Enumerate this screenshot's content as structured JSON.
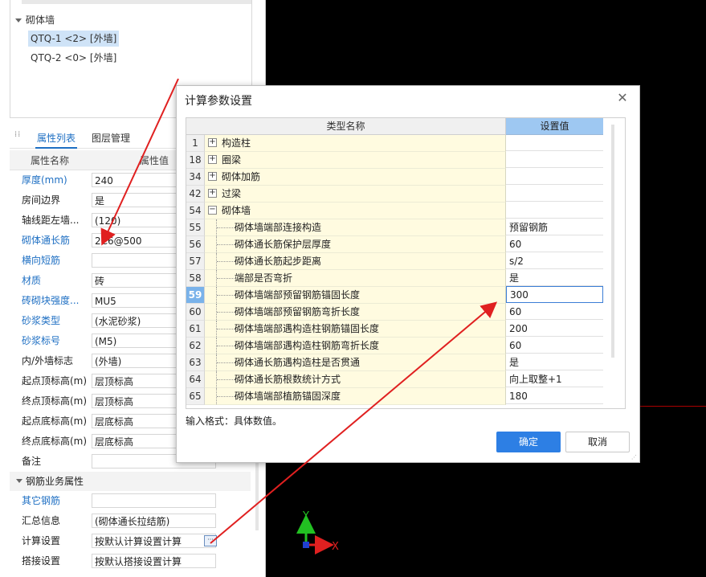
{
  "tree": {
    "group_label": "砌体墙",
    "items": [
      {
        "label": "QTQ-1 <2> [外墙]",
        "selected": true
      },
      {
        "label": "QTQ-2 <0> [外墙]",
        "selected": false
      }
    ]
  },
  "panel_tabs": {
    "properties": "属性列表",
    "layers": "图层管理"
  },
  "prop_header": {
    "name": "属性名称",
    "value": "属性值"
  },
  "props": [
    {
      "name": "厚度(mm)",
      "value": "240",
      "blue": true
    },
    {
      "name": "房间边界",
      "value": "是",
      "blue": false
    },
    {
      "name": "轴线距左墙...",
      "value": "(120)",
      "blue": false
    },
    {
      "name": "砌体通长筋",
      "value": "2C6@500",
      "blue": true
    },
    {
      "name": "横向短筋",
      "value": "",
      "blue": true
    },
    {
      "name": "材质",
      "value": "砖",
      "blue": true
    },
    {
      "name": "砖砌块强度...",
      "value": "MU5",
      "blue": true
    },
    {
      "name": "砂浆类型",
      "value": "(水泥砂浆)",
      "blue": true
    },
    {
      "name": "砂浆标号",
      "value": "(M5)",
      "blue": true
    },
    {
      "name": "内/外墙标志",
      "value": "(外墙)",
      "blue": false
    },
    {
      "name": "起点顶标高(m)",
      "value": "层顶标高",
      "blue": false
    },
    {
      "name": "终点顶标高(m)",
      "value": "层顶标高",
      "blue": false
    },
    {
      "name": "起点底标高(m)",
      "value": "层底标高",
      "blue": false
    },
    {
      "name": "终点底标高(m)",
      "value": "层底标高",
      "blue": false
    },
    {
      "name": "备注",
      "value": "",
      "blue": false
    }
  ],
  "rebar_section": {
    "title": "钢筋业务属性",
    "rows": [
      {
        "name": "其它钢筋",
        "value": "",
        "blue": true
      },
      {
        "name": "汇总信息",
        "value": "(砌体通长拉结筋)",
        "blue": false
      },
      {
        "name": "计算设置",
        "value": "按默认计算设置计算",
        "blue": false
      },
      {
        "name": "搭接设置",
        "value": "按默认搭接设置计算",
        "blue": false
      }
    ]
  },
  "dialog": {
    "title": "计算参数设置",
    "close_icon": "close-icon",
    "col_name": "类型名称",
    "col_value": "设置值",
    "rows": [
      {
        "num": "1",
        "name": "构造柱",
        "value": "",
        "group": true,
        "expanded": false
      },
      {
        "num": "18",
        "name": "圈梁",
        "value": "",
        "group": true,
        "expanded": false
      },
      {
        "num": "34",
        "name": "砌体加筋",
        "value": "",
        "group": true,
        "expanded": false
      },
      {
        "num": "42",
        "name": "过梁",
        "value": "",
        "group": true,
        "expanded": false
      },
      {
        "num": "54",
        "name": "砌体墙",
        "value": "",
        "group": true,
        "expanded": true
      },
      {
        "num": "55",
        "name": "砌体墙端部连接构造",
        "value": "预留钢筋"
      },
      {
        "num": "56",
        "name": "砌体通长筋保护层厚度",
        "value": "60"
      },
      {
        "num": "57",
        "name": "砌体通长筋起步距离",
        "value": "s/2"
      },
      {
        "num": "58",
        "name": "端部是否弯折",
        "value": "是"
      },
      {
        "num": "59",
        "name": "砌体墙端部预留钢筋锚固长度",
        "value": "300",
        "editing": true
      },
      {
        "num": "60",
        "name": "砌体墙端部预留钢筋弯折长度",
        "value": "60"
      },
      {
        "num": "61",
        "name": "砌体墙端部遇构造柱钢筋锚固长度",
        "value": "200"
      },
      {
        "num": "62",
        "name": "砌体墙端部遇构造柱钢筋弯折长度",
        "value": "60"
      },
      {
        "num": "63",
        "name": "砌体通长筋遇构造柱是否贯通",
        "value": "是"
      },
      {
        "num": "64",
        "name": "砌体通长筋根数统计方式",
        "value": "向上取整+1"
      },
      {
        "num": "65",
        "name": "砌体墙端部植筋锚固深度",
        "value": "180"
      }
    ],
    "hint": "输入格式：具体数值。",
    "ok_label": "确定",
    "cancel_label": "取消"
  },
  "axes": {
    "x_label": "X",
    "y_label": "Y"
  },
  "colors": {
    "accent": "#2d7fe4",
    "arrow": "#e02020",
    "axis_x": "#e02020",
    "axis_y": "#22c022"
  }
}
